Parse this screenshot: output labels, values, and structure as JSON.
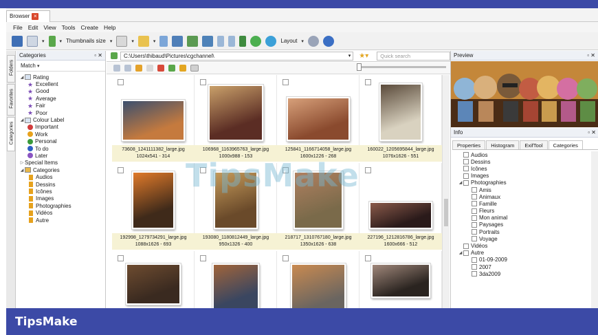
{
  "window": {
    "tab_label": "Browser"
  },
  "menu": [
    "File",
    "Edit",
    "View",
    "Tools",
    "Create",
    "Help"
  ],
  "toolbar": {
    "thumbnails_label": "Thumbnails size",
    "layout_label": "Layout"
  },
  "side_tabs": [
    "Folders",
    "Favorites",
    "Categories"
  ],
  "categories_panel": {
    "title": "Categories",
    "match_label": "Match",
    "tree": [
      {
        "label": "Rating",
        "level": 0,
        "icon": "rating-icon"
      },
      {
        "label": "Excellent",
        "level": 1,
        "icon": "star-icon"
      },
      {
        "label": "Good",
        "level": 1,
        "icon": "star-icon"
      },
      {
        "label": "Average",
        "level": 1,
        "icon": "star-icon"
      },
      {
        "label": "Fair",
        "level": 1,
        "icon": "star-icon"
      },
      {
        "label": "Poor",
        "level": 1,
        "icon": "star-icon"
      },
      {
        "label": "Colour Label",
        "level": 0,
        "icon": "label-icon"
      },
      {
        "label": "Important",
        "level": 1,
        "icon": "dot-icon",
        "color": "#d23b3b"
      },
      {
        "label": "Work",
        "level": 1,
        "icon": "dot-icon",
        "color": "#e8a21c"
      },
      {
        "label": "Personal",
        "level": 1,
        "icon": "dot-icon",
        "color": "#3a9a3a"
      },
      {
        "label": "To do",
        "level": 1,
        "icon": "dot-icon",
        "color": "#2f5fc4"
      },
      {
        "label": "Later",
        "level": 1,
        "icon": "dot-icon",
        "color": "#8a55c2"
      },
      {
        "label": "Special Items",
        "level": 0,
        "icon": "none"
      },
      {
        "label": "Categories",
        "level": 0,
        "icon": "folder-icon"
      },
      {
        "label": "Audios",
        "level": 1,
        "icon": "tag-icon"
      },
      {
        "label": "Dessins",
        "level": 1,
        "icon": "tag-icon"
      },
      {
        "label": "Icônes",
        "level": 1,
        "icon": "tag-icon"
      },
      {
        "label": "Images",
        "level": 1,
        "icon": "tag-icon"
      },
      {
        "label": "Photographies",
        "level": 1,
        "icon": "tag-icon"
      },
      {
        "label": "Vidéos",
        "level": 1,
        "icon": "tag-icon"
      },
      {
        "label": "Autre",
        "level": 1,
        "icon": "tag-icon"
      }
    ]
  },
  "address": {
    "path": "C:\\Users\\thibaud\\Pictures\\cgchannel\\",
    "search_placeholder": "Quick search"
  },
  "thumbnails": [
    {
      "name": "73608_1241111382_large.jpg",
      "info": "1024x541 - 314"
    },
    {
      "name": "106968_1163965763_large.jpg",
      "info": "1000x988 - 153"
    },
    {
      "name": "125841_1166714058_large.jpg",
      "info": "1600x1226 - 268"
    },
    {
      "name": "160022_1205695844_large.jpg",
      "info": "1076x1626 - 551"
    },
    {
      "name": "192998_1279734291_large.jpg",
      "info": "1088x1626 - 693"
    },
    {
      "name": "193080_1180812449_large.jpg",
      "info": "950x1326 - 400"
    },
    {
      "name": "218717_1310767180_large.jpg",
      "info": "1350x1626 - 638"
    },
    {
      "name": "227196_1212816786_large.jpg",
      "info": "1600x666 - 512"
    },
    {
      "name": "",
      "info": ""
    },
    {
      "name": "",
      "info": ""
    },
    {
      "name": "",
      "info": ""
    },
    {
      "name": "",
      "info": ""
    }
  ],
  "preview": {
    "title": "Preview"
  },
  "info": {
    "title": "Info",
    "tabs": [
      "Properties",
      "Histogram",
      "ExifTool",
      "Categories"
    ],
    "active_tab": "Categories",
    "categories": [
      {
        "label": "Audios",
        "level": 1
      },
      {
        "label": "Dessins",
        "level": 1
      },
      {
        "label": "Icônes",
        "level": 1
      },
      {
        "label": "Images",
        "level": 1
      },
      {
        "label": "Photographies",
        "level": 0
      },
      {
        "label": "Amis",
        "level": 2
      },
      {
        "label": "Animaux",
        "level": 2
      },
      {
        "label": "Famille",
        "level": 2
      },
      {
        "label": "Fleurs",
        "level": 2
      },
      {
        "label": "Mon animal",
        "level": 2
      },
      {
        "label": "Paysages",
        "level": 2
      },
      {
        "label": "Portraits",
        "level": 2
      },
      {
        "label": "Voyage",
        "level": 2
      },
      {
        "label": "Vidéos",
        "level": 1
      },
      {
        "label": "Autre",
        "level": 0
      },
      {
        "label": "01-09-2009",
        "level": 2
      },
      {
        "label": "2007",
        "level": 2
      },
      {
        "label": "3da2009",
        "level": 2
      }
    ]
  },
  "watermark": "TipsMake",
  "footer": {
    "brand": "TipsMake"
  },
  "colors": {
    "brand_band": "#3c4aa6",
    "caption_bg": "#f6f2d4"
  }
}
